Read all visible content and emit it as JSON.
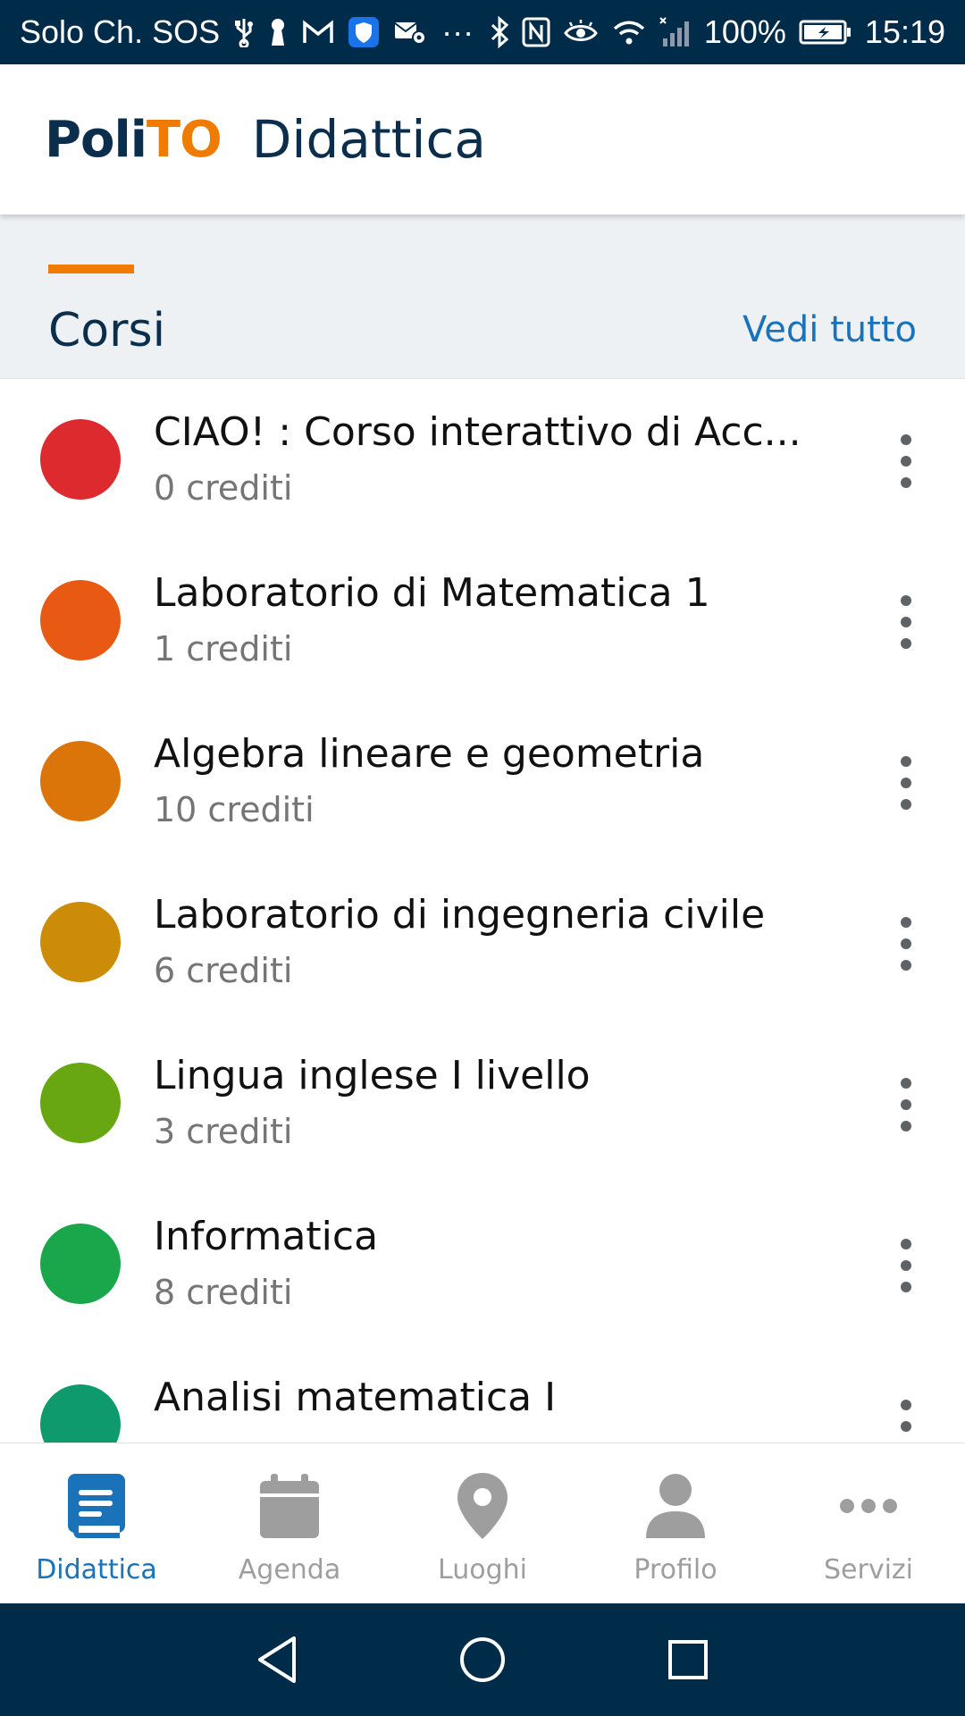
{
  "status_bar": {
    "carrier": "Solo Ch. SOS",
    "more": "···",
    "battery": "100%",
    "time": "15:19"
  },
  "header": {
    "logo_part1": "Poli",
    "logo_part2": "TO",
    "title": "Didattica"
  },
  "section": {
    "title": "Corsi",
    "see_all": "Vedi tutto"
  },
  "courses": [
    {
      "name": "CIAO! : Corso interattivo di Acc...",
      "credits": "0 crediti",
      "color": "#dd2a2f"
    },
    {
      "name": "Laboratorio di Matematica 1",
      "credits": "1 crediti",
      "color": "#e85a13"
    },
    {
      "name": "Algebra lineare e geometria",
      "credits": "10 crediti",
      "color": "#db7509"
    },
    {
      "name": "Laboratorio di ingegneria civile",
      "credits": "6 crediti",
      "color": "#cc8c07"
    },
    {
      "name": "Lingua inglese I livello",
      "credits": "3 crediti",
      "color": "#68a712"
    },
    {
      "name": "Informatica",
      "credits": "8 crediti",
      "color": "#1aa64a"
    },
    {
      "name": "Analisi matematica I",
      "credits": "",
      "color": "#0f9a6e"
    }
  ],
  "bottom_nav": {
    "tabs": [
      {
        "label": "Didattica",
        "icon": "book-icon",
        "active": true
      },
      {
        "label": "Agenda",
        "icon": "calendar-icon",
        "active": false
      },
      {
        "label": "Luoghi",
        "icon": "location-pin-icon",
        "active": false
      },
      {
        "label": "Profilo",
        "icon": "person-icon",
        "active": false
      },
      {
        "label": "Servizi",
        "icon": "more-horizontal-icon",
        "active": false
      }
    ]
  },
  "colors": {
    "brand_dark": "#0c2e4d",
    "brand_orange": "#ef7c00",
    "link_blue": "#1a73b8",
    "status_bar_bg": "#002b49"
  }
}
